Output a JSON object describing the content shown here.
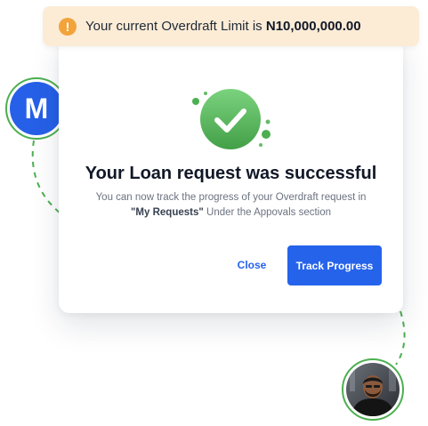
{
  "banner": {
    "icon": "warning-icon",
    "text_prefix": "Your current Overdraft Limit is ",
    "amount": "N10,000,000.00",
    "background": "#fcecd6",
    "icon_color": "#f2a43b"
  },
  "dialog": {
    "icon": "success-check-icon",
    "title": "Your Loan request was successful",
    "description_line1": "You can now track the progress of your Overdraft request in",
    "description_bold": "\"My Requests\"",
    "description_line2_rest": " Under the Appovals section",
    "close_label": "Close",
    "track_label": "Track Progress",
    "primary_color": "#2563eb",
    "success_color": "#4caf50"
  },
  "avatars": {
    "brand_letter": "M",
    "brand_color": "#2660e8",
    "user_photo": "user-avatar-photo",
    "ring_color": "#4caf50"
  }
}
